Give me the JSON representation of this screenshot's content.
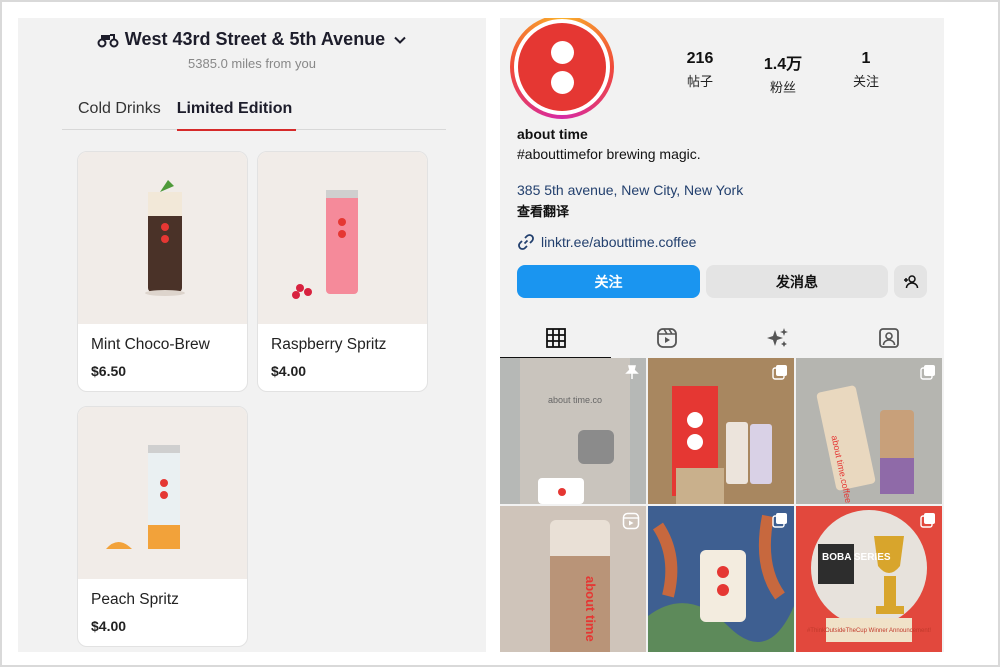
{
  "store": {
    "name": "West 43rd Street & 5th Avenue",
    "distance": "5385.0 miles from you"
  },
  "menu_tabs": [
    {
      "label": "Cold Drinks",
      "active": false
    },
    {
      "label": "Limited Edition",
      "active": true
    }
  ],
  "products": [
    {
      "name": "Mint Choco-Brew",
      "price": "$6.50"
    },
    {
      "name": "Raspberry Spritz",
      "price": "$4.00"
    },
    {
      "name": "Peach Spritz",
      "price": "$4.00"
    }
  ],
  "profile": {
    "stats": [
      {
        "value": "216",
        "label": "帖子"
      },
      {
        "value": "1.4万",
        "label": "粉丝"
      },
      {
        "value": "1",
        "label": "关注"
      }
    ],
    "name": "about time",
    "bio": "#abouttimefor brewing magic.",
    "address": "385 5th avenue, New City, New York",
    "translate": "查看翻译",
    "link": "linktr.ee/abouttime.coffee",
    "follow_label": "关注",
    "message_label": "发消息"
  },
  "grid_posts": [
    {
      "caption": "about time.co",
      "badge": "pin-icon"
    },
    {
      "caption": "",
      "badge": "multi-icon"
    },
    {
      "caption": "about time.coffee",
      "badge": "multi-icon"
    },
    {
      "caption": "about time",
      "badge": "reel-icon"
    },
    {
      "caption": "",
      "badge": "multi-icon"
    },
    {
      "caption": "BOBA SERIES",
      "overlay": "#ThinkOutsideTheCup Winner Announcement!",
      "badge": "multi-icon"
    }
  ],
  "colors": {
    "brand_red": "#e53733",
    "follow_blue": "#1a95f0",
    "link_blue": "#23406e"
  }
}
